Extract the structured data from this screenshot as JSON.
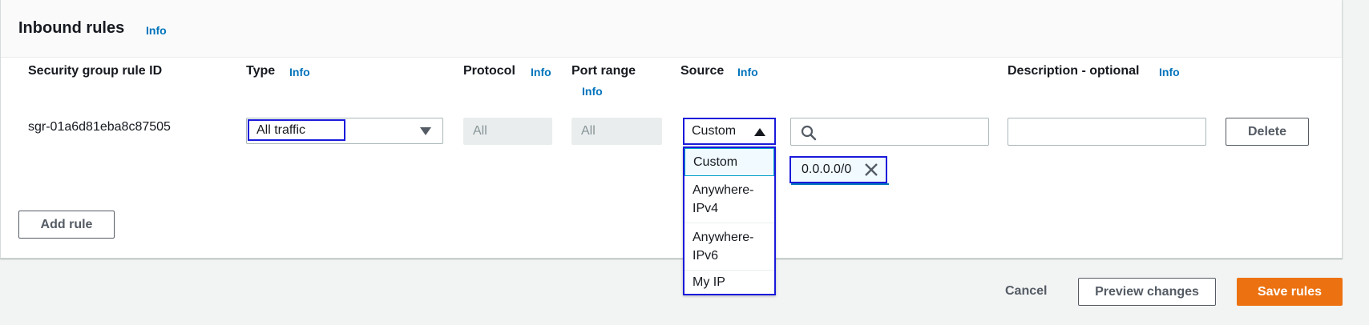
{
  "panel": {
    "title": "Inbound rules",
    "info_label": "Info"
  },
  "columns": {
    "rule_id": "Security group rule ID",
    "type": "Type",
    "protocol": "Protocol",
    "port_range": "Port range",
    "source": "Source",
    "description": "Description - optional",
    "info_label": "Info"
  },
  "rule": {
    "id": "sgr-01a6d81eba8c87505",
    "type_value": "All traffic",
    "protocol_value": "All",
    "port_range_value": "All",
    "source_value": "Custom",
    "source_options": [
      "Custom",
      "Anywhere-IPv4",
      "Anywhere-IPv6",
      "My IP"
    ],
    "source_options_display": [
      "Custom",
      "Anywhere-\nIPv4",
      "Anywhere-\nIPv6",
      "My IP"
    ],
    "cidr_token": "0.0.0.0/0",
    "search_value": "",
    "description_value": "",
    "delete_label": "Delete"
  },
  "actions": {
    "add_rule_label": "Add rule",
    "cancel_label": "Cancel",
    "preview_label": "Preview changes",
    "save_label": "Save rules"
  },
  "colors": {
    "accent_link": "#0073bb",
    "primary_button": "#ec7211",
    "highlight_outline": "#1a1adb"
  },
  "icons": {
    "type_caret": "chevron-down-icon",
    "source_caret": "chevron-up-icon",
    "search": "search-icon",
    "token_remove": "close-icon"
  }
}
